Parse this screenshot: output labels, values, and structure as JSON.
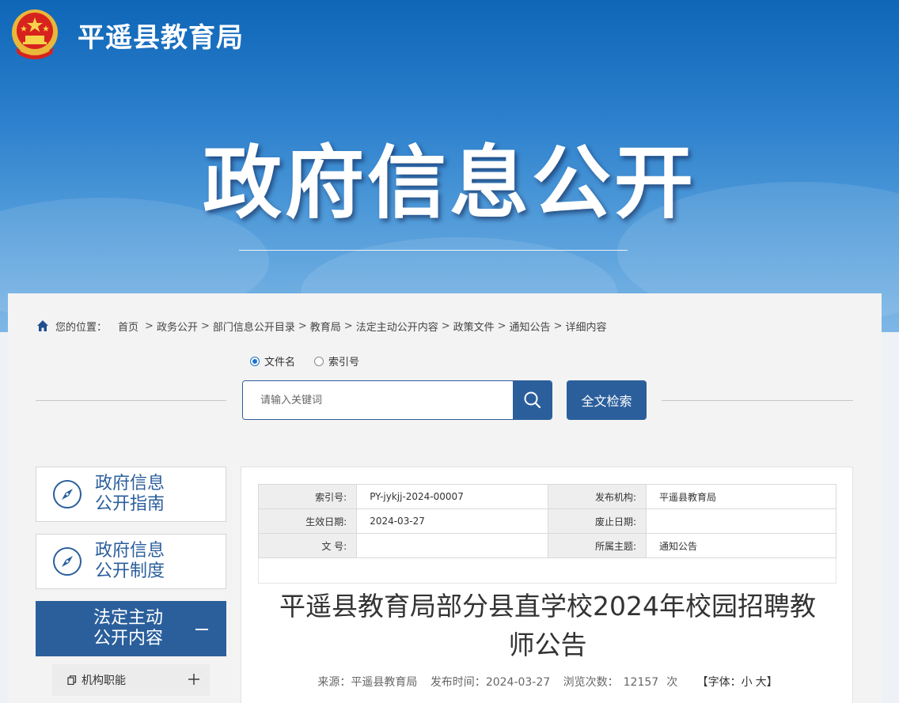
{
  "header": {
    "site_title": "平遥县教育局",
    "hero_title": "政府信息公开"
  },
  "breadcrumb": {
    "label": "您的位置：",
    "items": [
      "首页",
      "政务公开",
      "部门信息公开目录",
      "教育局",
      "法定主动公开内容",
      "政策文件",
      "通知公告",
      "详细内容"
    ],
    "separator": ">"
  },
  "search": {
    "options": [
      {
        "label": "文件名",
        "selected": true
      },
      {
        "label": "索引号",
        "selected": false
      }
    ],
    "placeholder": "请输入关键词",
    "fulltext_label": "全文检索",
    "icons": {
      "search": "search-icon"
    }
  },
  "sidebar": {
    "items": [
      {
        "label_line1": "政府信息",
        "label_line2": "公开指南",
        "icon": "compass-icon"
      },
      {
        "label_line1": "政府信息",
        "label_line2": "公开制度",
        "icon": "compass-icon"
      },
      {
        "label_line1": "法定主动",
        "label_line2": "公开内容",
        "active": true,
        "toggle": "minus-icon"
      }
    ],
    "sub_items": [
      {
        "label": "机构职能",
        "icon": "document-icon",
        "toggle": "plus-icon"
      }
    ]
  },
  "meta": {
    "index_label": "索引号:",
    "index_value": "PY-jykjj-2024-00007",
    "publisher_label": "发布机构:",
    "publisher_value": "平遥县教育局",
    "effective_label": "生效日期:",
    "effective_value": "2024-03-27",
    "repeal_label": "废止日期:",
    "repeal_value": "",
    "docno_label": "文 号:",
    "docno_value": "",
    "topic_label": "所属主题:",
    "topic_value": "通知公告"
  },
  "article": {
    "title_line1": "平遥县教育局部分县直学校2024年校园招聘教",
    "title_line2": "师公告",
    "source_label": "来源：",
    "source_value": "平遥县教育局",
    "time_label": "发布时间：",
    "time_value": "2024-03-27",
    "views_label": "浏览次数：",
    "views_value": "12157",
    "views_unit": "次",
    "font_label": "【字体：",
    "font_small": "小",
    "font_large": "大",
    "font_close": "】"
  },
  "colors": {
    "brand_blue": "#2b5f9c",
    "banner_top": "#0f66b7",
    "banner_bottom": "#7eb7e6"
  }
}
